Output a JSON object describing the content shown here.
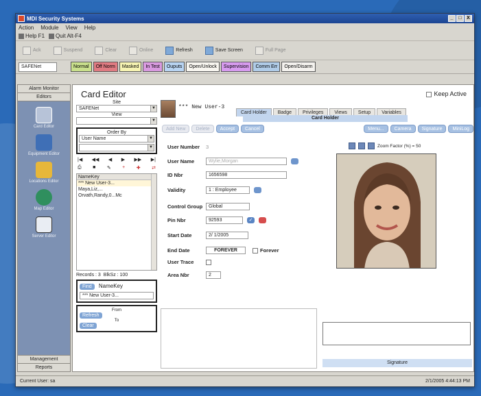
{
  "app": {
    "title": "MDI Security Systems",
    "window_buttons": [
      "_",
      "□",
      "X"
    ]
  },
  "menu": [
    "Action",
    "Module",
    "View",
    "Help"
  ],
  "toolbar1": [
    {
      "label": "Help F1"
    },
    {
      "label": "Quit Alt-F4"
    }
  ],
  "toolbar2": [
    {
      "label": "Ack",
      "active": false
    },
    {
      "label": "Suspend",
      "active": false
    },
    {
      "label": "Clear",
      "active": false
    },
    {
      "label": "Online",
      "active": false
    },
    {
      "label": "Refresh",
      "active": true
    },
    {
      "label": "Save Screen",
      "active": true
    },
    {
      "label": "Full Page",
      "active": false
    }
  ],
  "status_row": {
    "site": "SAFENet",
    "boxes": [
      {
        "label": "Normal",
        "color": "#c9e08c"
      },
      {
        "label": "Off Norm",
        "color": "#e07b82"
      },
      {
        "label": "Masked",
        "color": "#f6f3b2"
      },
      {
        "label": "In Test",
        "color": "#d99ae0"
      },
      {
        "label": "Ouputs",
        "color": "#b8d4f2"
      },
      {
        "label": "Open/Unlock",
        "color": "#f8f6f0"
      },
      {
        "label": "Supervision",
        "color": "#d79bef"
      },
      {
        "label": "Comm Err",
        "color": "#b0cce8"
      },
      {
        "label": "Open/Disarm",
        "color": "#f4f2ee"
      }
    ]
  },
  "leftnav": {
    "header": "Alarm Monitor",
    "section": "Editors",
    "items": [
      {
        "label": "Card Editor",
        "color": "#b7c3d8"
      },
      {
        "label": "Equipment Editor",
        "color": "#3f6fb6"
      },
      {
        "label": "Locations Editor",
        "color": "#e7b73a"
      },
      {
        "label": "Map Editor",
        "color": "#2f8f5e"
      },
      {
        "label": "Server Editor",
        "color": "#e9edf3"
      }
    ],
    "footer1": "Management",
    "footer2": "Reports"
  },
  "card_editor": {
    "title": "Card Editor",
    "keep_active": "Keep Active",
    "site_label": "Site",
    "site_value": "SAFENet",
    "view_label": "View",
    "orderby_label": "Order By",
    "orderby_value": "User Name",
    "list": [
      "NameKey",
      "*** New User-3...",
      "Maya,Liz,...",
      "Orvath,Randy,0...Mc"
    ],
    "records": "Records : 3",
    "blksz": "BlkSz : 100",
    "find_btn": "Find",
    "find_label": "NameKey",
    "find_value": "*** New User-3...",
    "from_label": "From",
    "to_label": "To",
    "refresh_btn": "Refresh",
    "clear_btn": "Clear"
  },
  "record": {
    "new_user": "*** New User-3",
    "tabs": [
      "Card Holder",
      "Badge",
      "Privileges",
      "Views",
      "Setup",
      "Variables"
    ],
    "tab_title": "Card Holder",
    "actions_left": [
      "Add New",
      "Delete",
      "Accept",
      "Cancel"
    ],
    "actions_right": [
      "Menu...",
      "Camera",
      "Signature",
      "MiniLog"
    ],
    "fields": {
      "user_number_label": "User Number",
      "user_number": "3",
      "user_name_label": "User Name",
      "user_name": "Wylie,Morgan",
      "id_nbr_label": "ID Nbr",
      "id_nbr": "1656598",
      "validity_label": "Validity",
      "validity": "1 : Employee",
      "control_group_label": "Control Group",
      "control_group": "Global",
      "pin_label": "Pin Nbr",
      "pin": "92593",
      "start_date_label": "Start Date",
      "start_date": "2/ 1/2005",
      "end_date_label": "End Date",
      "end_date": "FOREVER",
      "forever_label": "Forever",
      "user_trace_label": "User Trace",
      "area_nbr_label": "Area Nbr",
      "area_nbr": "2"
    },
    "zoom_label": "Zoom Factor (%) = 50",
    "signature_label": "Signature"
  },
  "statusbar": {
    "current_user": "Current User: sa",
    "datetime": "2/1/2005 4:44:13 PM"
  }
}
